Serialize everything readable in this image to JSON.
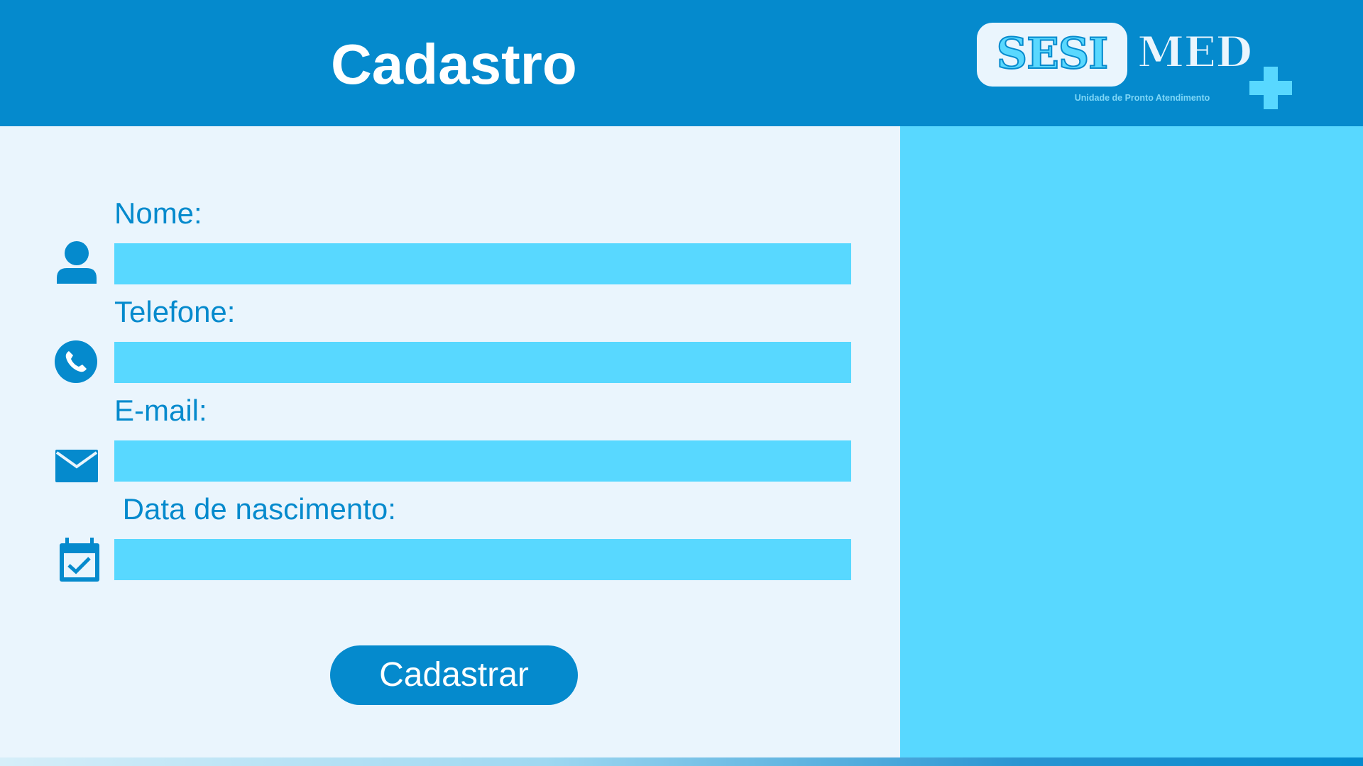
{
  "header": {
    "title": "Cadastro"
  },
  "logo": {
    "part1": "SESI",
    "part2": "MED",
    "subtitle": "Unidade de Pronto Atendimento",
    "icon": "plus-icon"
  },
  "form": {
    "fields": [
      {
        "label": "Nome:",
        "value": "",
        "icon": "user-icon"
      },
      {
        "label": "Telefone:",
        "value": "",
        "icon": "phone-icon"
      },
      {
        "label": "E-mail:",
        "value": "",
        "icon": "envelope-icon"
      },
      {
        "label": " Data de nascimento:",
        "value": "",
        "icon": "calendar-check-icon"
      }
    ],
    "submit_label": "Cadastrar"
  },
  "colors": {
    "header_bg": "#058acd",
    "page_bg": "#eaf5fd",
    "accent_light": "#58d8ff",
    "text_primary": "#058acd",
    "button_text": "#ffffff"
  }
}
